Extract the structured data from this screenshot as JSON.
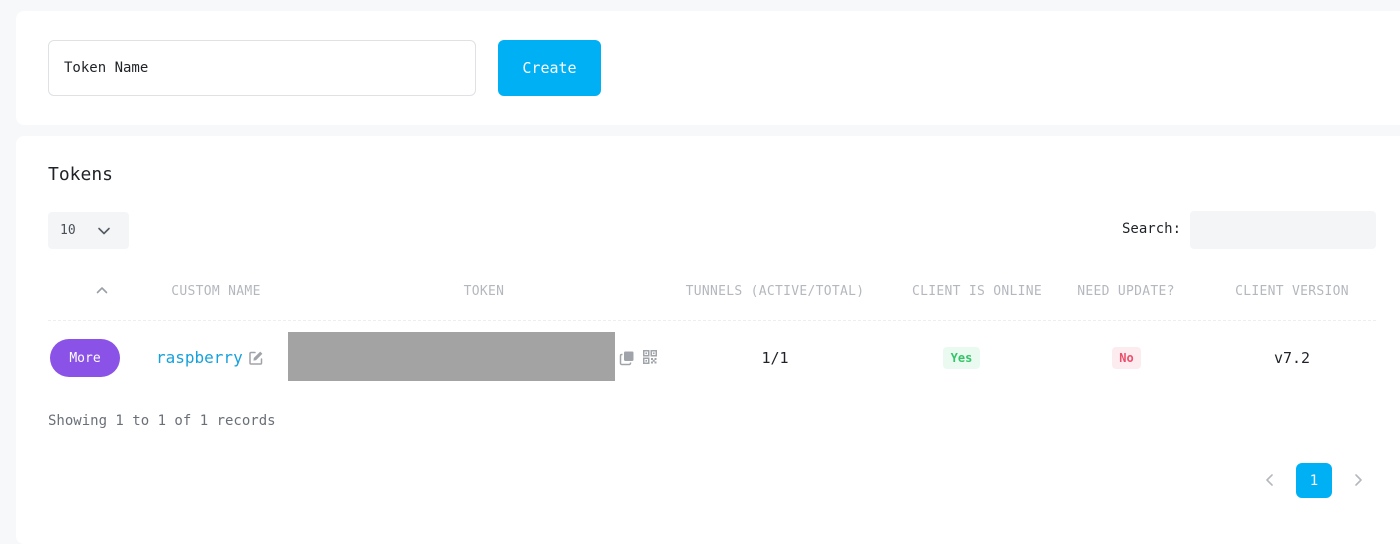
{
  "create_form": {
    "token_name_value": "Token Name",
    "create_label": "Create"
  },
  "tokens_section": {
    "title": "Tokens",
    "page_length": "10",
    "search_label": "Search:",
    "search_value": "",
    "columns": {
      "custom_name": "CUSTOM NAME",
      "token": "TOKEN",
      "tunnels": "TUNNELS (ACTIVE/TOTAL)",
      "client_online": "CLIENT IS ONLINE",
      "need_update": "NEED UPDATE?",
      "client_version": "CLIENT VERSION"
    },
    "rows": [
      {
        "more_label": "More",
        "custom_name": "raspberry",
        "tunnels": "1/1",
        "client_online": "Yes",
        "need_update": "No",
        "client_version": "v7.2"
      }
    ],
    "showing_text": "Showing 1 to 1 of 1 records",
    "pagination": {
      "current_page": "1"
    }
  },
  "colors": {
    "accent": "#00b0f5",
    "more_button": "#8a52e6",
    "link": "#15a1dc",
    "success": "#35c46a",
    "danger": "#ec4d6b",
    "token_mask": "#a3a3a3"
  },
  "icons": {
    "sort": "chevron-up-icon",
    "length_dropdown": "chevron-down-icon",
    "edit": "edit-icon",
    "copy": "copy-icon",
    "qr": "qr-code-icon",
    "prev": "chevron-left-icon",
    "next": "chevron-right-icon"
  }
}
